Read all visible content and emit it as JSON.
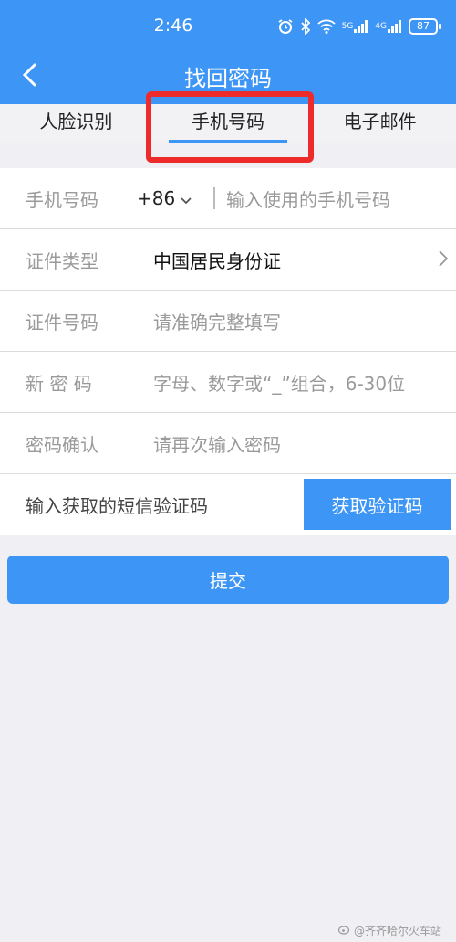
{
  "status_bar": {
    "time": "2:46",
    "battery": "87",
    "icons": [
      "alarm-icon",
      "bluetooth-icon",
      "wifi-icon",
      "signal-5g-icon",
      "signal-4g-icon"
    ],
    "signal_5g": "5G",
    "signal_4g": "4G"
  },
  "header": {
    "back_icon": "chevron-left-icon",
    "title": "找回密码"
  },
  "tabs": [
    {
      "label": "人脸识别",
      "active": false
    },
    {
      "label": "手机号码",
      "active": true
    },
    {
      "label": "电子邮件",
      "active": false
    }
  ],
  "form": {
    "phone": {
      "label": "手机号码",
      "country_code": "+86",
      "placeholder": "输入使用的手机号码"
    },
    "id_type": {
      "label": "证件类型",
      "value": "中国居民身份证"
    },
    "id_number": {
      "label": "证件号码",
      "placeholder": "请准确完整填写"
    },
    "new_password": {
      "label": "新 密 码",
      "placeholder": "字母、数字或“_”组合，6-30位"
    },
    "confirm_password": {
      "label": "密码确认",
      "placeholder": "请再次输入密码"
    },
    "sms": {
      "placeholder": "输入获取的短信验证码",
      "button": "获取验证码"
    }
  },
  "submit_label": "提交",
  "watermark": "@齐齐哈尔火车站",
  "colors": {
    "accent": "#3d95f5",
    "highlight": "#ee2b2b",
    "background": "#f0f0f4"
  }
}
